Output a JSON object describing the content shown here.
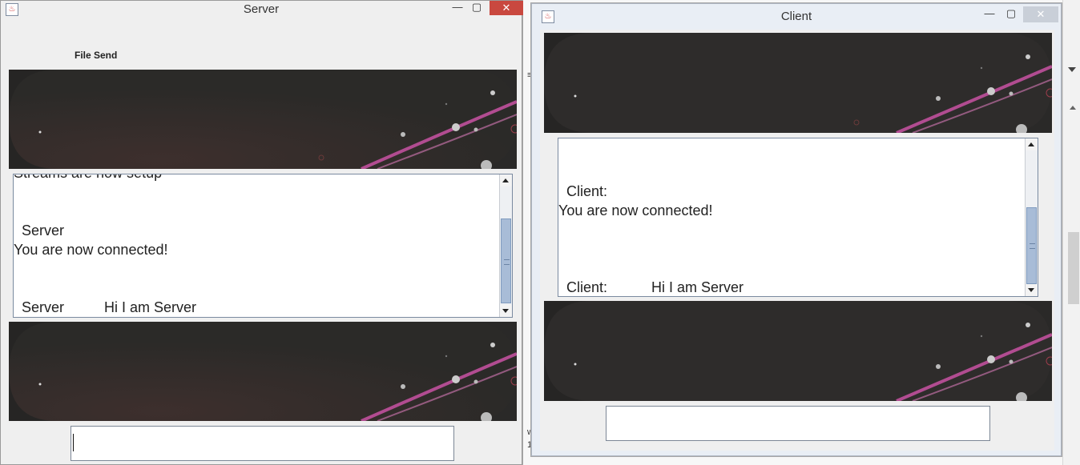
{
  "server": {
    "title": "Server",
    "controls": {
      "minimize": "—",
      "maximize": "▢",
      "close": "✕"
    },
    "menu_label": "File Send",
    "chat_lines": [
      "Streams are now setup",
      "  Server",
      "You are now connected!",
      "  Server          Hi I am Server"
    ],
    "input_value": ""
  },
  "client": {
    "title": "Client",
    "controls": {
      "minimize": "—",
      "maximize": "▢",
      "close": "✕"
    },
    "chat_lines": [
      "  Client:",
      "You are now connected!",
      "  Client:           Hi I am Server"
    ],
    "input_value": ""
  },
  "background_app": {
    "fragments": [
      "≡",
      "w",
      "1"
    ]
  },
  "colors": {
    "close_red": "#c9483f",
    "banner_dark": "#2f2d2b",
    "banner_streak": "#c0509c",
    "scroll_thumb": "#a8bcd7"
  },
  "icons": {
    "app_icon": "java-cup-icon",
    "close": "close-icon",
    "minimize": "minimize-icon",
    "maximize": "maximize-icon"
  }
}
